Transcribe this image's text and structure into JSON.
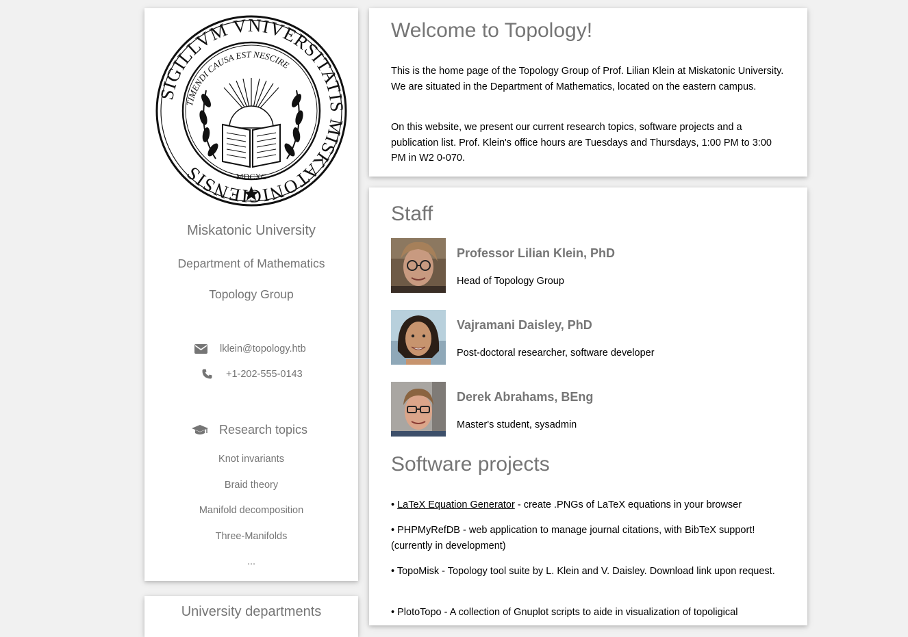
{
  "sidebar": {
    "university": "Miskatonic University",
    "department": "Department of Mathematics",
    "group": "Topology Group",
    "seal": {
      "outer_text": "SIGILLVM VNIVERSITATIS MISKATONICIENSIS",
      "inner_text": "TIMENDI CAUSA EST NESCIRE",
      "year": "MDCXC"
    },
    "contact": {
      "email": "lklein@topology.htb",
      "phone": "+1-202-555-0143"
    },
    "research_title": "Research topics",
    "topics": [
      "Knot invariants",
      "Braid theory",
      "Manifold decomposition",
      "Three-Manifolds",
      "..."
    ],
    "departments_title": "University departments"
  },
  "welcome": {
    "title": "Welcome to Topology!",
    "para1": "This is the home page of the Topology Group of Prof. Lilian Klein at Miskatonic University. We are situated in the Department of Mathematics, located on the eastern campus.",
    "para2": "On this website, we present our current research topics, software projects and a publication list. Prof. Klein's office hours are Tuesdays and Thursdays, 1:00 PM to 3:00 PM in W2 0-070."
  },
  "staff": {
    "title": "Staff",
    "members": [
      {
        "name": "Professor Lilian Klein, PhD",
        "role": "Head of Topology Group"
      },
      {
        "name": "Vajramani Daisley, PhD",
        "role": "Post-doctoral researcher, software developer"
      },
      {
        "name": "Derek Abrahams, BEng",
        "role": "Master's student, sysadmin"
      }
    ]
  },
  "software": {
    "title": "Software projects",
    "bullet": "•",
    "items": [
      {
        "link": "LaTeX Equation Generator",
        "text": " - create .PNGs of LaTeX equations in your browser"
      },
      {
        "text": "PHPMyRefDB - web application to manage journal citations, with BibTeX support! (currently in development)"
      },
      {
        "text": "TopoMisk - Topology tool suite by L. Klein and V. Daisley. Download link upon request."
      },
      {
        "text": "PlotoTopo - A collection of Gnuplot scripts to aide in visualization of topoligical"
      }
    ]
  }
}
